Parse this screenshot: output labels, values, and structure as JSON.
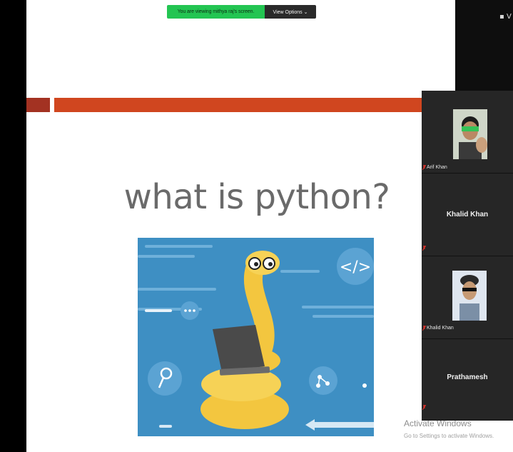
{
  "share_banner": {
    "text": "You are viewing mithya raj's screen.",
    "button": "View Options ⌄"
  },
  "top_right_label": "▪ V",
  "slide": {
    "title": "what is python?"
  },
  "participants": [
    {
      "name": "Arif Khan",
      "mic_muted": true
    },
    {
      "center_name": "Khalid Khan",
      "mic_muted": true
    },
    {
      "name": "Khalid Khan",
      "mic_muted": true
    },
    {
      "center_name": "Prathamesh",
      "mic_muted": true
    }
  ],
  "watermark": {
    "line1": "Activate Windows",
    "line2": "Go to Settings to activate Windows."
  },
  "colors": {
    "band_main": "#d0461f",
    "band_dark": "#a33222",
    "banner_green": "#23c552",
    "illustration_blue": "#3e8fc3",
    "python_yellow": "#f3c63f",
    "mute_red": "#e0322b"
  }
}
